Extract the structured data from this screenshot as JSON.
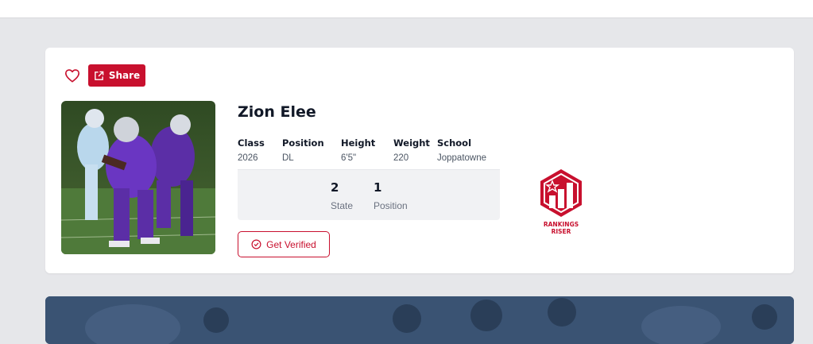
{
  "profile": {
    "share_label": "Share",
    "name": "Zion Elee",
    "stats": {
      "class": {
        "label": "Class",
        "value": "2026"
      },
      "position": {
        "label": "Position",
        "value": "DL"
      },
      "height": {
        "label": "Height",
        "value": "6'5\""
      },
      "weight": {
        "label": "Weight",
        "value": "220"
      },
      "school": {
        "label": "School",
        "value": "Joppatowne"
      }
    },
    "rankings": {
      "state": {
        "value": "2",
        "label": "State"
      },
      "position": {
        "value": "1",
        "label": "Position"
      }
    },
    "verify_label": "Get Verified",
    "badge": {
      "line1": "RANKINGS",
      "line2": "RISER"
    }
  },
  "icons": {
    "favorite": "heart-icon",
    "share": "external-link-icon",
    "verify": "check-circle-icon"
  },
  "colors": {
    "accent": "#c8102e",
    "page_bg": "#e6e7ea",
    "card_bg": "#ffffff",
    "rank_box_bg": "#f1f2f4",
    "banner_bg": "#3c5678"
  }
}
